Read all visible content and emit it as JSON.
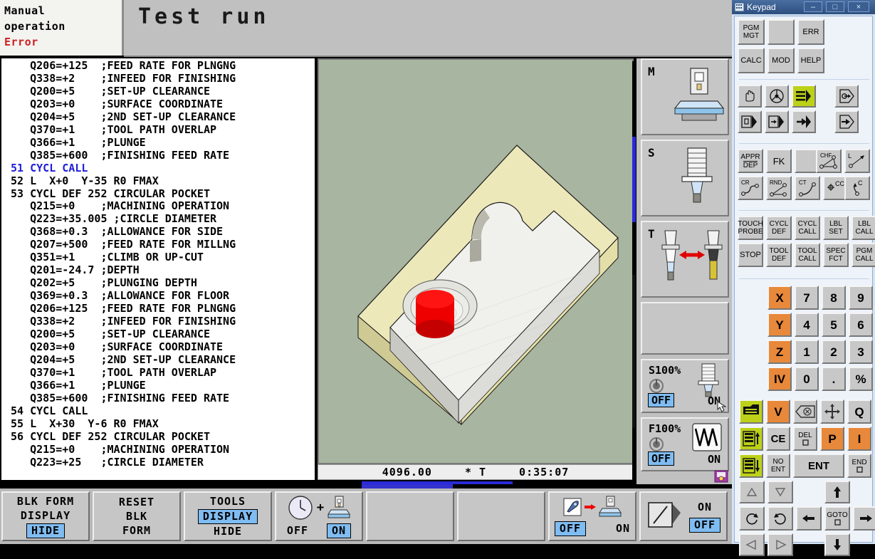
{
  "header": {
    "mode_line1": "Manual",
    "mode_line2": "operation",
    "status": "Error",
    "title": "Test run"
  },
  "program": {
    "lines": [
      {
        "text": "    Q206=+125  ;FEED RATE FOR PLNGNG",
        "highlight": false
      },
      {
        "text": "    Q338=+2    ;INFEED FOR FINISHING",
        "highlight": false
      },
      {
        "text": "    Q200=+5    ;SET-UP CLEARANCE",
        "highlight": false
      },
      {
        "text": "    Q203=+0    ;SURFACE COORDINATE",
        "highlight": false
      },
      {
        "text": "    Q204=+5    ;2ND SET-UP CLEARANCE",
        "highlight": false
      },
      {
        "text": "    Q370=+1    ;TOOL PATH OVERLAP",
        "highlight": false
      },
      {
        "text": "    Q366=+1    ;PLUNGE",
        "highlight": false
      },
      {
        "text": "    Q385=+600  ;FINISHING FEED RATE",
        "highlight": false
      },
      {
        "text": " 51 CYCL CALL",
        "highlight": true
      },
      {
        "text": " 52 L  X+0  Y-35 R0 FMAX",
        "highlight": false
      },
      {
        "text": " 53 CYCL DEF 252 CIRCULAR POCKET",
        "highlight": false
      },
      {
        "text": "    Q215=+0    ;MACHINING OPERATION",
        "highlight": false
      },
      {
        "text": "    Q223=+35.005 ;CIRCLE DIAMETER",
        "highlight": false
      },
      {
        "text": "    Q368=+0.3  ;ALLOWANCE FOR SIDE",
        "highlight": false
      },
      {
        "text": "    Q207=+500  ;FEED RATE FOR MILLNG",
        "highlight": false
      },
      {
        "text": "    Q351=+1    ;CLIMB OR UP-CUT",
        "highlight": false
      },
      {
        "text": "    Q201=-24.7 ;DEPTH",
        "highlight": false
      },
      {
        "text": "    Q202=+5    ;PLUNGING DEPTH",
        "highlight": false
      },
      {
        "text": "    Q369=+0.3  ;ALLOWANCE FOR FLOOR",
        "highlight": false
      },
      {
        "text": "    Q206=+125  ;FEED RATE FOR PLNGNG",
        "highlight": false
      },
      {
        "text": "    Q338=+2    ;INFEED FOR FINISHING",
        "highlight": false
      },
      {
        "text": "    Q200=+5    ;SET-UP CLEARANCE",
        "highlight": false
      },
      {
        "text": "    Q203=+0    ;SURFACE COORDINATE",
        "highlight": false
      },
      {
        "text": "    Q204=+5    ;2ND SET-UP CLEARANCE",
        "highlight": false
      },
      {
        "text": "    Q370=+1    ;TOOL PATH OVERLAP",
        "highlight": false
      },
      {
        "text": "    Q366=+1    ;PLUNGE",
        "highlight": false
      },
      {
        "text": "    Q385=+600  ;FINISHING FEED RATE",
        "highlight": false
      },
      {
        "text": " 54 CYCL CALL",
        "highlight": false
      },
      {
        "text": " 55 L  X+30  Y-6 R0 FMAX",
        "highlight": false
      },
      {
        "text": " 56 CYCL DEF 252 CIRCULAR POCKET",
        "highlight": false
      },
      {
        "text": "    Q215=+0    ;MACHINING OPERATION",
        "highlight": false
      },
      {
        "text": "    Q223=+25   ;CIRCLE DIAMETER",
        "highlight": false
      }
    ]
  },
  "graphics": {
    "status_value": "4096.00",
    "status_symbol": "*  T",
    "status_time": "0:35:07",
    "background_color": "#a8b5a0",
    "workpiece_top_color": "#eeeeea",
    "workpiece_blank_color": "#ece8ba",
    "tool_color": "#ee0000"
  },
  "status_column": {
    "m_label": "M",
    "s_label": "S",
    "t_label": "T",
    "spindle_override": {
      "label": "S100%",
      "off": "OFF",
      "on": "ON"
    },
    "feed_override": {
      "label": "F100%",
      "off": "OFF",
      "on": "ON"
    }
  },
  "softkeys": [
    {
      "name": "blk-form-display",
      "lines": [
        "BLK FORM",
        "DISPLAY",
        "HIDE"
      ],
      "highlight_index": 2
    },
    {
      "name": "reset-blk-form",
      "lines": [
        "RESET",
        "BLK",
        "FORM"
      ],
      "highlight_index": -1
    },
    {
      "name": "tools-display",
      "lines": [
        "TOOLS",
        "DISPLAY",
        "HIDE"
      ],
      "highlight_index": 1
    },
    {
      "name": "machining-time",
      "lines": [
        "OFF",
        "ON"
      ],
      "highlight_index": 1
    },
    {
      "name": "empty-1",
      "lines": [],
      "highlight_index": -1
    },
    {
      "name": "empty-2",
      "lines": [],
      "highlight_index": -1
    },
    {
      "name": "rapid-traverse",
      "lines": [
        "OFF",
        "ON"
      ],
      "highlight_index": 0
    },
    {
      "name": "section-view",
      "lines": [
        "ON",
        "OFF"
      ],
      "highlight_index": 1
    }
  ],
  "keypad": {
    "window_title": "Keypad",
    "window_buttons": {
      "minimize": "–",
      "maximize": "□",
      "close": "×"
    },
    "group_file": [
      {
        "name": "pgm-mgt",
        "lines": [
          "PGM",
          "MGT"
        ],
        "style": "text"
      },
      {
        "name": "blank-1",
        "lines": [],
        "style": "text"
      },
      {
        "name": "err",
        "lines": [
          "ERR"
        ],
        "style": "text"
      },
      {
        "name": "calc",
        "lines": [
          "CALC"
        ],
        "style": "text"
      },
      {
        "name": "mod",
        "lines": [
          "MOD"
        ],
        "style": "text"
      },
      {
        "name": "help",
        "lines": [
          "HELP"
        ],
        "style": "text"
      }
    ],
    "group_modes": [
      {
        "name": "manual-operation",
        "icon": "hand-icon",
        "accent": "grey"
      },
      {
        "name": "electronic-handwheel",
        "icon": "handwheel-icon",
        "accent": "grey"
      },
      {
        "name": "program-run-full-sequence",
        "icon": "program-run-icon",
        "accent": "green"
      },
      {
        "name": "program-input",
        "icon": "program-input-icon",
        "accent": "grey"
      },
      {
        "name": "positioning-with-mdi",
        "icon": "mdi-icon",
        "accent": "grey"
      },
      {
        "name": "test-run",
        "icon": "test-run-icon",
        "accent": "grey"
      },
      {
        "name": "single-block",
        "icon": "single-block-icon",
        "accent": "grey"
      },
      {
        "name": "program-run-single",
        "icon": "program-run-single-icon",
        "accent": "grey"
      }
    ],
    "group_path": [
      {
        "name": "appr-dep",
        "lines": [
          "APPR",
          "DEP"
        ]
      },
      {
        "name": "fk",
        "lines": [
          "FK"
        ]
      },
      {
        "name": "blank-path",
        "lines": []
      },
      {
        "name": "chamfer",
        "lines": [
          "CHF"
        ]
      },
      {
        "name": "line",
        "lines": [
          "L"
        ]
      },
      {
        "name": "circle-radius",
        "lines": [
          "CR"
        ]
      },
      {
        "name": "rounding",
        "lines": [
          "RND"
        ]
      },
      {
        "name": "circle-tangential",
        "lines": [
          "CT"
        ]
      },
      {
        "name": "circle-center",
        "lines": [
          "CC"
        ]
      },
      {
        "name": "circle",
        "lines": [
          "C"
        ]
      }
    ],
    "group_cycles": [
      {
        "name": "touch-probe",
        "lines": [
          "TOUCH",
          "PROBE"
        ]
      },
      {
        "name": "cycl-def",
        "lines": [
          "CYCL",
          "DEF"
        ]
      },
      {
        "name": "cycl-call",
        "lines": [
          "CYCL",
          "CALL"
        ]
      },
      {
        "name": "lbl-set",
        "lines": [
          "LBL",
          "SET"
        ]
      },
      {
        "name": "lbl-call",
        "lines": [
          "LBL",
          "CALL"
        ]
      },
      {
        "name": "stop",
        "lines": [
          "STOP"
        ]
      },
      {
        "name": "tool-def",
        "lines": [
          "TOOL",
          "DEF"
        ]
      },
      {
        "name": "tool-call",
        "lines": [
          "TOOL",
          "CALL"
        ]
      },
      {
        "name": "spec-fct",
        "lines": [
          "SPEC",
          "FCT"
        ]
      },
      {
        "name": "pgm-call",
        "lines": [
          "PGM",
          "CALL"
        ]
      }
    ],
    "group_numeric": [
      {
        "name": "axis-x",
        "label": "X",
        "accent": "orange"
      },
      {
        "name": "digit-7",
        "label": "7",
        "accent": "grey"
      },
      {
        "name": "digit-8",
        "label": "8",
        "accent": "grey"
      },
      {
        "name": "digit-9",
        "label": "9",
        "accent": "grey"
      },
      {
        "name": "axis-y",
        "label": "Y",
        "accent": "orange"
      },
      {
        "name": "digit-4",
        "label": "4",
        "accent": "grey"
      },
      {
        "name": "digit-5",
        "label": "5",
        "accent": "grey"
      },
      {
        "name": "digit-6",
        "label": "6",
        "accent": "grey"
      },
      {
        "name": "axis-z",
        "label": "Z",
        "accent": "orange"
      },
      {
        "name": "digit-1",
        "label": "1",
        "accent": "grey"
      },
      {
        "name": "digit-2",
        "label": "2",
        "accent": "grey"
      },
      {
        "name": "digit-3",
        "label": "3",
        "accent": "grey"
      },
      {
        "name": "axis-iv",
        "label": "IV",
        "accent": "orange"
      },
      {
        "name": "digit-0",
        "label": "0",
        "accent": "grey"
      },
      {
        "name": "decimal-point",
        "label": ".",
        "accent": "grey"
      },
      {
        "name": "sign-toggle",
        "label": "%",
        "accent": "grey"
      }
    ],
    "group_edit": [
      {
        "name": "note-pad",
        "label": "",
        "accent": "green",
        "icon": "pages-icon"
      },
      {
        "name": "axis-v",
        "label": "V",
        "accent": "orange"
      },
      {
        "name": "backspace",
        "label": "",
        "accent": "grey",
        "icon": "backspace-icon"
      },
      {
        "name": "actual-position-capture",
        "label": "",
        "accent": "grey",
        "icon": "crosshair-icon"
      },
      {
        "name": "q-parameter",
        "label": "Q",
        "accent": "grey"
      },
      {
        "name": "page-up",
        "label": "",
        "accent": "green",
        "icon": "page-up-icon"
      },
      {
        "name": "ce",
        "label": "CE",
        "accent": "grey"
      },
      {
        "name": "del",
        "label": "DEL",
        "accent": "grey"
      },
      {
        "name": "axis-p",
        "label": "P",
        "accent": "orange"
      },
      {
        "name": "axis-i",
        "label": "I",
        "accent": "orange"
      },
      {
        "name": "page-down",
        "label": "",
        "accent": "green",
        "icon": "page-down-icon"
      },
      {
        "name": "no-ent",
        "label": "NO ENT",
        "accent": "grey"
      },
      {
        "name": "ent",
        "label": "ENT",
        "accent": "grey"
      },
      {
        "name": "end",
        "label": "END",
        "accent": "grey"
      }
    ],
    "group_nav": [
      {
        "name": "arrow-up-small",
        "icon": "triangle-up-icon"
      },
      {
        "name": "arrow-down-small",
        "icon": "triangle-down-icon"
      },
      {
        "name": "arrow-up",
        "icon": "arrow-up-icon"
      },
      {
        "name": "rotate-ccw",
        "icon": "rotate-ccw-icon"
      },
      {
        "name": "rotate-cw",
        "icon": "rotate-cw-icon"
      },
      {
        "name": "arrow-left",
        "icon": "arrow-left-icon"
      },
      {
        "name": "goto",
        "label": "GOTO"
      },
      {
        "name": "arrow-right",
        "icon": "arrow-right-icon"
      },
      {
        "name": "arrow-prev",
        "icon": "triangle-left-icon"
      },
      {
        "name": "arrow-next",
        "icon": "triangle-right-icon"
      },
      {
        "name": "arrow-down",
        "icon": "arrow-down-icon"
      }
    ]
  }
}
